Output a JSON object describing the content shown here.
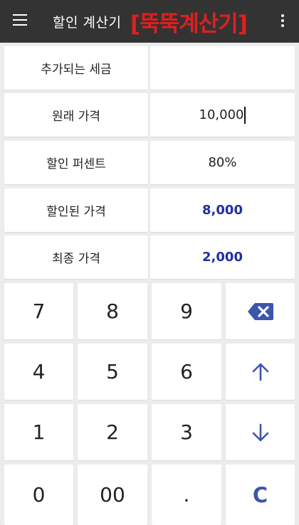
{
  "appbar": {
    "title": "할인 계산기",
    "logo_text": "[뚝뚝계산기]"
  },
  "fields": [
    {
      "label": "추가되는 세금",
      "value": ""
    },
    {
      "label": "원래 가격",
      "value": "10,000"
    },
    {
      "label": "할인 퍼센트",
      "value": "80%"
    },
    {
      "label": "할인된 가격",
      "value": "8,000"
    },
    {
      "label": "최종 가격",
      "value": "2,000"
    }
  ],
  "keypad": {
    "k7": "7",
    "k8": "8",
    "k9": "9",
    "k4": "4",
    "k5": "5",
    "k6": "6",
    "k1": "1",
    "k2": "2",
    "k3": "3",
    "k0": "0",
    "k00": "00",
    "kdot": ".",
    "clear": "C"
  },
  "icons": {
    "menu": "menu-icon",
    "overflow": "overflow-menu-icon",
    "backspace": "backspace-icon",
    "up": "arrow-up-icon",
    "down": "arrow-down-icon"
  },
  "colors": {
    "appbar_bg": "#333333",
    "logo": "#e01f1f",
    "highlight_value": "#1f2fa0",
    "action_key": "#3c56a8",
    "background": "#ececec"
  }
}
